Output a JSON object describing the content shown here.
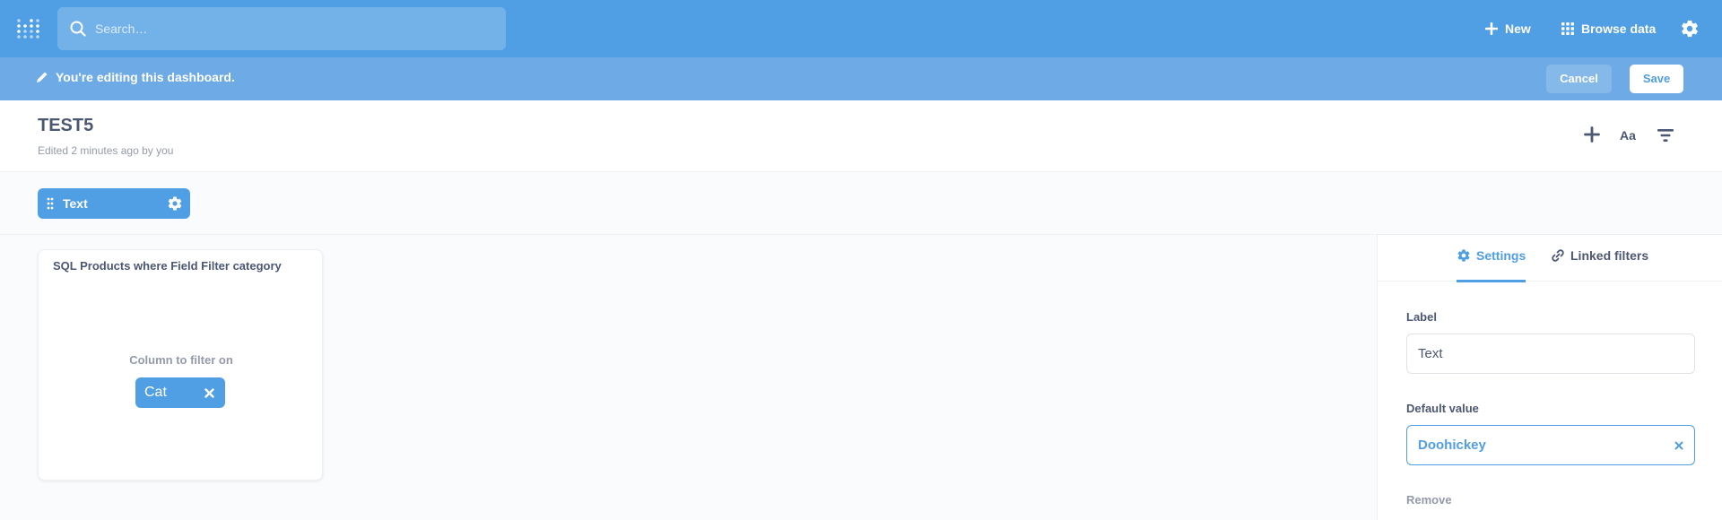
{
  "topnav": {
    "search_placeholder": "Search…",
    "new_label": "New",
    "browse_label": "Browse data"
  },
  "editbar": {
    "message": "You're editing this dashboard.",
    "cancel_label": "Cancel",
    "save_label": "Save"
  },
  "dashboard": {
    "title": "TEST5",
    "subtitle": "Edited 2 minutes ago by you",
    "text_icon_label": "Aa"
  },
  "filter": {
    "label": "Text"
  },
  "card": {
    "title": "SQL Products where Field Filter category",
    "column_label": "Column to filter on",
    "chip_label": "Cat"
  },
  "sidebar": {
    "tab_settings": "Settings",
    "tab_linked": "Linked filters",
    "label_heading": "Label",
    "label_value": "Text",
    "default_heading": "Default value",
    "default_value": "Doohickey",
    "remove_label": "Remove"
  },
  "colors": {
    "brand": "#509ee3",
    "edit_bar": "#6eabe6",
    "text_dark": "#4c5773",
    "text_light": "#949aab"
  }
}
